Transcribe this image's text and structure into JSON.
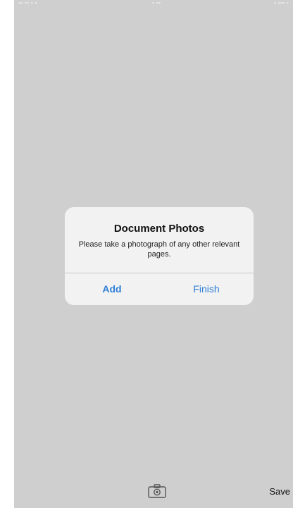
{
  "status_bar": {
    "left": "▪▪ ▪▪ ▪ ▪",
    "center": "▪ ▪▪",
    "right": "▪ ▪▪▪ ▪"
  },
  "alert": {
    "title": "Document Photos",
    "message": "Please take a photograph of any other relevant pages.",
    "add_label": "Add",
    "finish_label": "Finish"
  },
  "toolbar": {
    "camera_icon": "camera-icon",
    "save_label": "Save"
  },
  "colors": {
    "background": "#cfcfcf",
    "alert_background": "#f2f2f2",
    "accent": "#2f7fd6"
  }
}
